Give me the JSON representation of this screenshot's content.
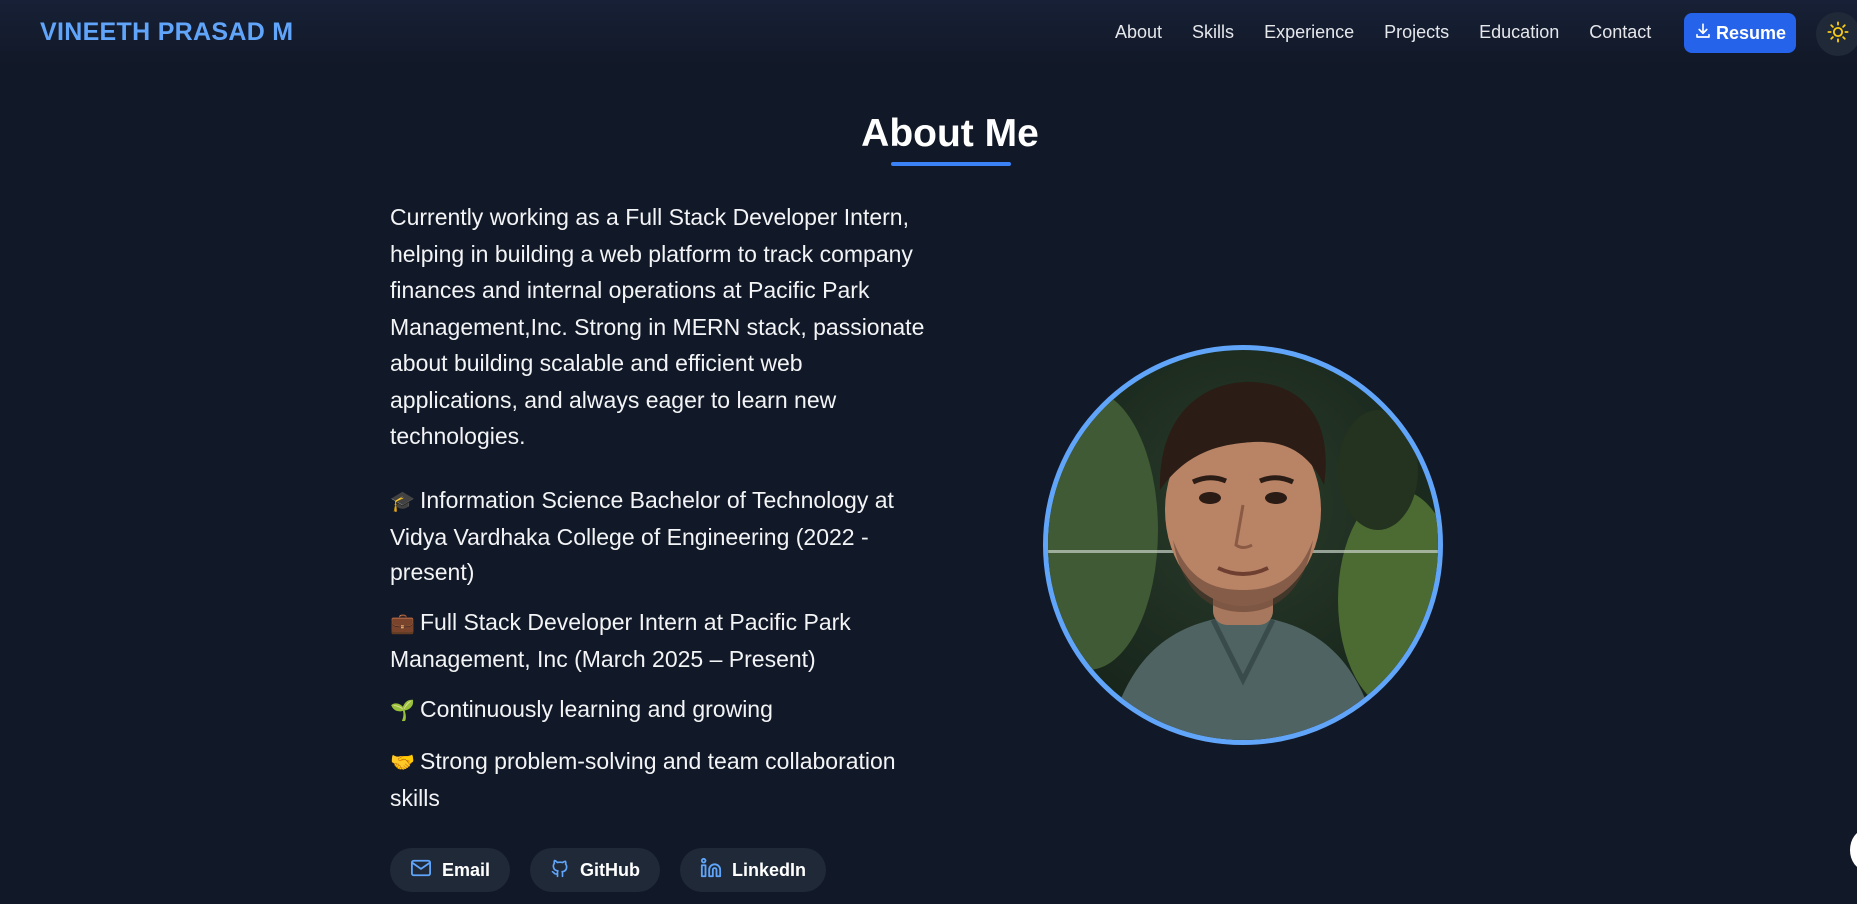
{
  "header": {
    "brand": "VINEETH PRASAD M",
    "nav": [
      "About",
      "Skills",
      "Experience",
      "Projects",
      "Education",
      "Contact"
    ],
    "resume_label": "Resume",
    "theme_icon": "sun-icon"
  },
  "about": {
    "title": "About Me",
    "intro": "Currently working as a Full Stack Developer Intern, helping in building a web platform to track company finances and internal operations at Pacific Park Management,Inc. Strong in MERN stack, passionate about building scalable and efficient web applications, and always eager to learn new technologies.",
    "facts": [
      {
        "emoji": "🎓",
        "text": "Information Science Bachelor of Technology at Vidya Vardhaka College of Engineering (2022 - present)"
      },
      {
        "emoji": "💼",
        "text": "Full Stack Developer Intern at Pacific Park Management, Inc (March 2025 – Present)"
      },
      {
        "emoji": "🌱",
        "text": "Continuously learning and growing"
      },
      {
        "emoji": "🤝",
        "text": "Strong problem-solving and team collaboration skills"
      }
    ],
    "contacts": [
      {
        "label": "Email",
        "icon": "mail-icon"
      },
      {
        "label": "GitHub",
        "icon": "github-icon"
      },
      {
        "label": "LinkedIn",
        "icon": "linkedin-icon"
      }
    ]
  },
  "colors": {
    "background": "#111827",
    "accent": "#3b82f6",
    "brand": "#60a5fa",
    "button": "#2563eb",
    "sun": "#facc15"
  }
}
